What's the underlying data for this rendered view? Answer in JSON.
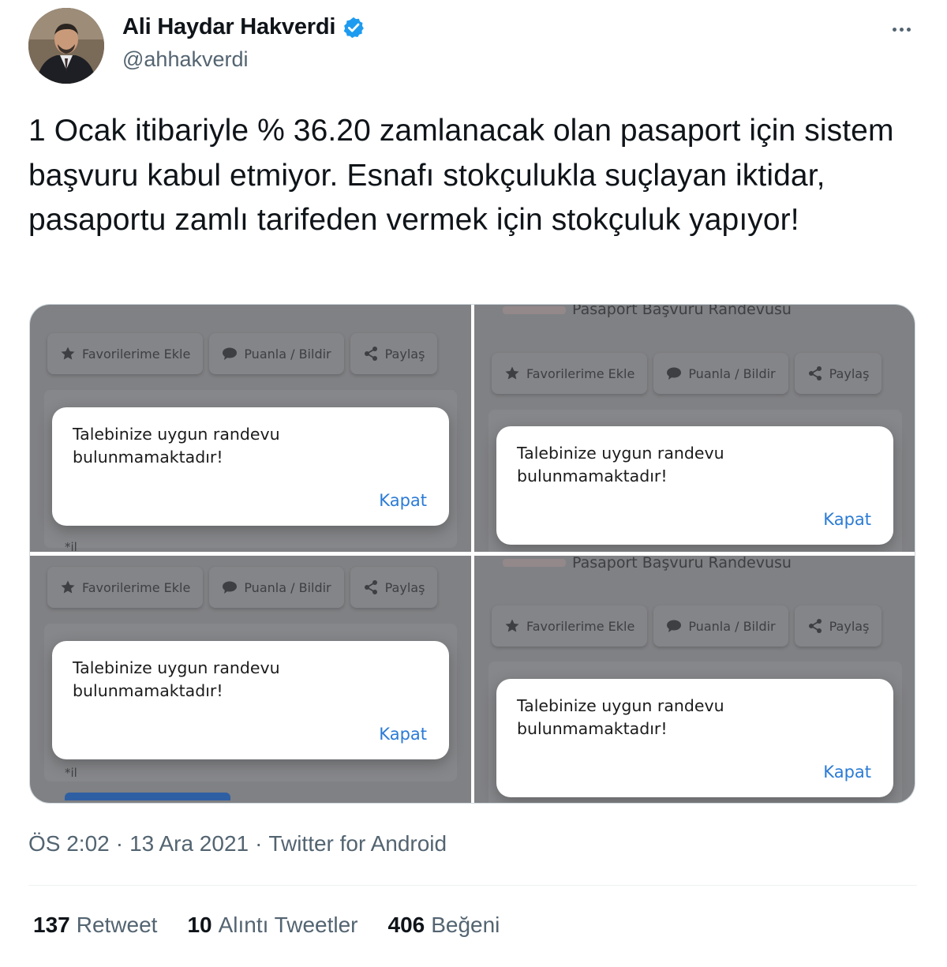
{
  "author": {
    "display_name": "Ali Haydar Hakverdi",
    "handle": "@ahhakverdi",
    "verified": true
  },
  "tweet": {
    "text": "1 Ocak itibariyle % 36.20 zamlanacak olan pasaport için sistem başvuru kabul etmiyor. Esnafı stokçulukla suçlayan iktidar, pasaportu zamlı tarifeden vermek için stokçuluk yapıyor!"
  },
  "media": {
    "page_title": "Pasaport Başvuru Randevusu",
    "buttons": {
      "favorites": "Favorilerime Ekle",
      "rate": "Puanla / Bildir",
      "share": "Paylaş"
    },
    "dialog": {
      "message": "Talebinize uygun randevu bulunmamaktadır!",
      "close_label": "Kapat"
    },
    "bottom_mark": "*il"
  },
  "meta": {
    "time": "ÖS 2:02",
    "date": "13 Ara 2021",
    "source": "Twitter for Android",
    "separator": "·"
  },
  "stats": {
    "retweets": {
      "count": "137",
      "label": "Retweet"
    },
    "quotes": {
      "count": "10",
      "label": "Alıntı Tweetler"
    },
    "likes": {
      "count": "406",
      "label": "Beğeni"
    }
  },
  "colors": {
    "text_primary": "#0f1419",
    "text_secondary": "#536471",
    "verified_blue": "#1d9bf0",
    "dialog_link": "#2b7bd6",
    "overlay_gray": "#808184"
  }
}
